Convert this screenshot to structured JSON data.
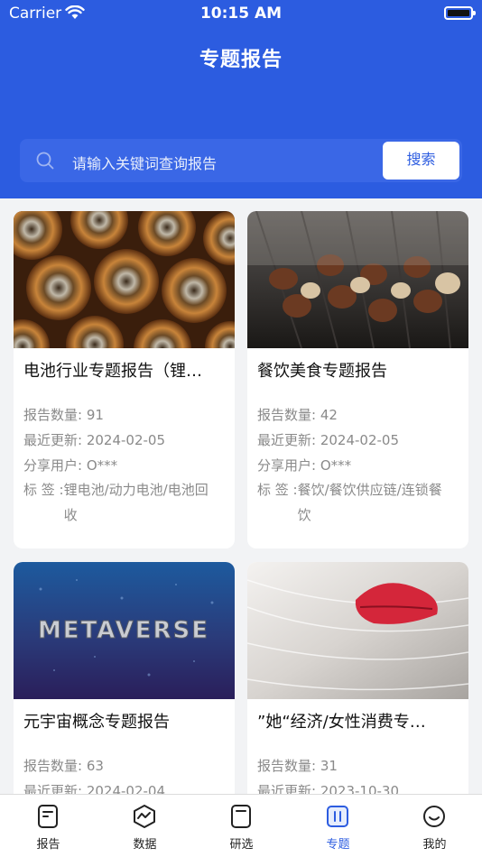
{
  "status_bar": {
    "carrier": "Carrier",
    "time": "10:15 AM"
  },
  "header": {
    "title": "专题报告"
  },
  "search": {
    "placeholder": "请输入关键词查询报告",
    "button_label": "搜索"
  },
  "cards": [
    {
      "title": "电池行业专题报告（锂…",
      "count_label": "报告数量: 91",
      "updated_label": "最近更新: 2024-02-05",
      "user_label": "分享用户: O***",
      "tags_label": "标 签 :",
      "tags_value": "锂电池/动力电池/电池回收",
      "image": "batteries-photo"
    },
    {
      "title": "餐饮美食专题报告",
      "count_label": "报告数量: 42",
      "updated_label": "最近更新: 2024-02-05",
      "user_label": "分享用户: O***",
      "tags_label": "标 签 :",
      "tags_value": "餐饮/餐饮供应链/连锁餐饮",
      "image": "skewers-photo"
    },
    {
      "title": "元宇宙概念专题报告",
      "count_label": "报告数量: 63",
      "updated_label": "最近更新: 2024-02-04",
      "image": "metaverse-image",
      "image_text": "METAVERSE"
    },
    {
      "title": "”她“经济/女性消费专…",
      "count_label": "报告数量: 31",
      "updated_label": "最近更新: 2023-10-30",
      "image": "lips-photo"
    }
  ],
  "tabbar": {
    "items": [
      {
        "label": "报告",
        "icon": "report-icon"
      },
      {
        "label": "数据",
        "icon": "data-icon"
      },
      {
        "label": "研选",
        "icon": "research-icon"
      },
      {
        "label": "专题",
        "icon": "topic-icon",
        "active": true
      },
      {
        "label": "我的",
        "icon": "profile-icon"
      }
    ]
  },
  "colors": {
    "brand": "#2c5ce0",
    "meta_text": "#8a8a8a",
    "background": "#f2f3f5"
  }
}
